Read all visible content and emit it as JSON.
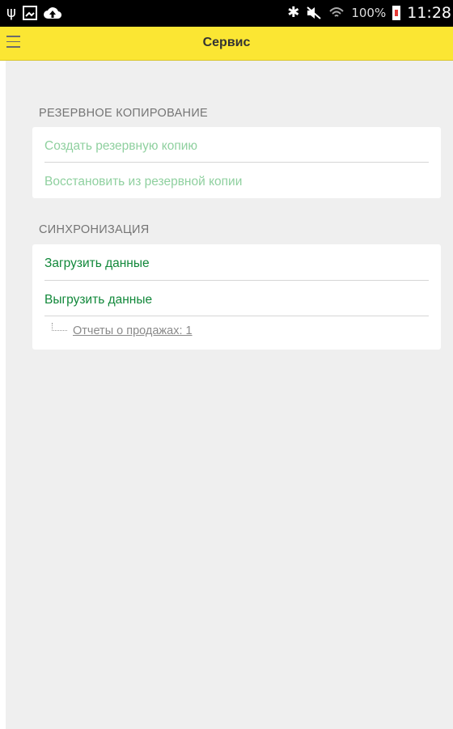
{
  "status_bar": {
    "left_icons": [
      "usb-icon",
      "image-icon",
      "cloud-upload-icon"
    ],
    "right_icons": [
      "bluetooth-icon",
      "mute-icon",
      "wifi-icon"
    ],
    "battery_percent": "100%",
    "time": "11:28"
  },
  "header": {
    "title": "Сервис",
    "menu_icon": "hamburger-menu-icon",
    "background_color": "#fbe633"
  },
  "backup_section": {
    "title": "РЕЗЕРВНОЕ КОПИРОВАНИЕ",
    "items": [
      {
        "label": "Создать резервную копию"
      },
      {
        "label": "Восстановить из резервной копии"
      }
    ]
  },
  "sync_section": {
    "title": "СИНХРОНИЗАЦИЯ",
    "items": [
      {
        "label": "Загрузить данные"
      },
      {
        "label": "Выгрузить данные"
      }
    ],
    "report_link": "Отчеты о продажах: 1"
  },
  "colors": {
    "accent_green": "#11883a",
    "disabled_green": "#8fd09f"
  }
}
